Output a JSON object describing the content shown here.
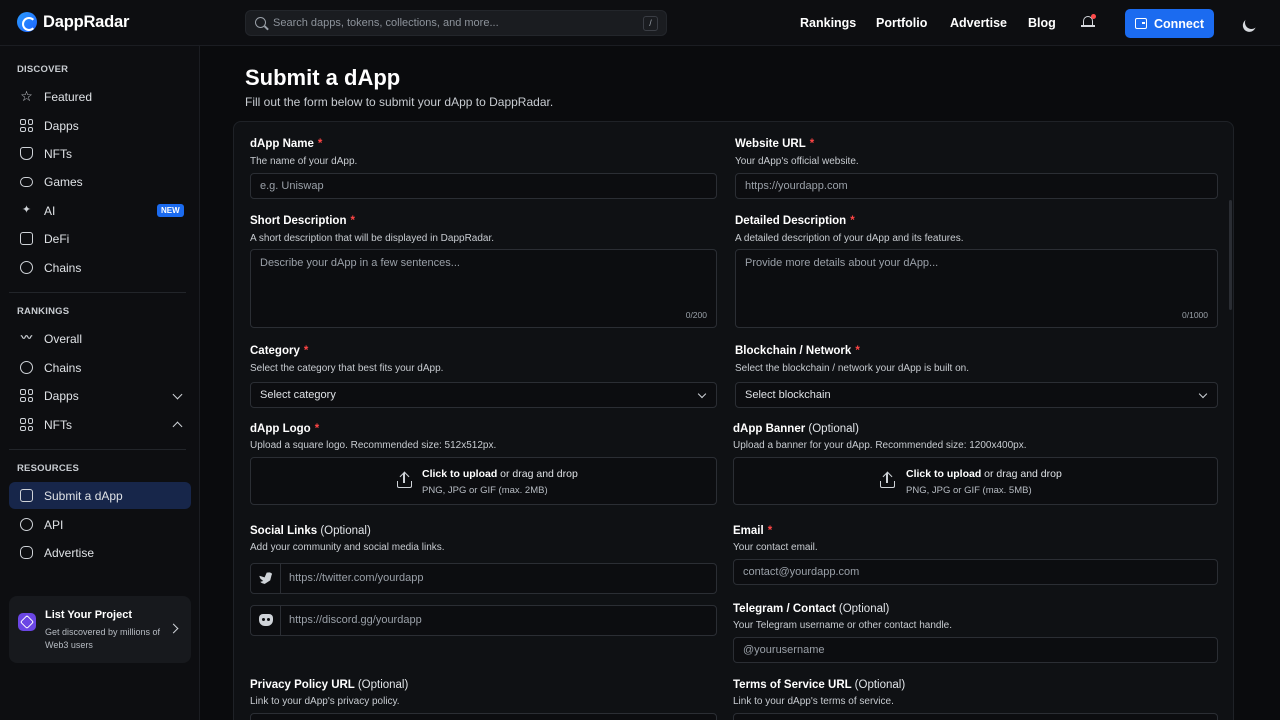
{
  "brand": {
    "name": "DappRadar"
  },
  "search": {
    "placeholder": "Search dapps, tokens, collections, and more...",
    "shortcut": "/"
  },
  "topnav": {
    "items": [
      "Rankings",
      "Portfolio",
      "Advertise",
      "Blog"
    ],
    "connect": "Connect"
  },
  "colors": {
    "accent": "#1b6bf0",
    "active_bg": "#17264a",
    "required": "#ff4545",
    "notification": "#ff4b4b"
  },
  "sidebar": {
    "discover_title": "DISCOVER",
    "discover": [
      {
        "label": "Featured",
        "icon": "star-icon"
      },
      {
        "label": "Dapps",
        "icon": "grid-icon"
      },
      {
        "label": "NFTs",
        "icon": "nft-icon"
      },
      {
        "label": "Games",
        "icon": "gamepad-icon"
      },
      {
        "label": "AI",
        "icon": "ai-sparkle-icon",
        "badge": "NEW"
      },
      {
        "label": "DeFi",
        "icon": "defi-icon"
      },
      {
        "label": "Chains",
        "icon": "chains-icon"
      }
    ],
    "rankings_title": "RANKINGS",
    "rankings": [
      {
        "label": "Overall",
        "icon": "trend-icon"
      },
      {
        "label": "Chains",
        "icon": "chains-icon"
      },
      {
        "label": "Dapps",
        "icon": "grid-icon",
        "chevron": "down"
      },
      {
        "label": "NFTs",
        "icon": "grid-icon",
        "chevron": "up"
      }
    ],
    "resources_title": "RESOURCES",
    "resources": [
      {
        "label": "Submit a dApp",
        "icon": "submit-icon",
        "active": true
      },
      {
        "label": "API",
        "icon": "api-icon"
      },
      {
        "label": "Advertise",
        "icon": "advertise-icon"
      }
    ],
    "promo": {
      "title": "List Your Project",
      "desc": "Get discovered by millions of Web3 users"
    }
  },
  "page": {
    "title": "Submit a dApp",
    "subtitle": "Fill out the form below to submit your dApp to DappRadar."
  },
  "form": {
    "dapp_name": {
      "label": "dApp Name",
      "help": "The name of your dApp.",
      "placeholder": "e.g. Uniswap"
    },
    "website": {
      "label": "Website URL",
      "help": "Your dApp's official website.",
      "placeholder": "https://yourdapp.com"
    },
    "short_desc": {
      "label": "Short Description",
      "help": "A short description that will be displayed in DappRadar.",
      "placeholder": "Describe your dApp in a few sentences...",
      "counter": "0/200"
    },
    "detailed_desc": {
      "label": "Detailed Description",
      "help": "A detailed description of your dApp and its features.",
      "placeholder": "Provide more details about your dApp...",
      "counter": "0/1000"
    },
    "category": {
      "label": "Category",
      "help": "Select the category that best fits your dApp.",
      "value": "Select category"
    },
    "blockchain": {
      "label": "Blockchain / Network",
      "help": "Select the blockchain / network your dApp is built on.",
      "value": "Select blockchain"
    },
    "logo": {
      "label": "dApp Logo",
      "help": "Upload a square logo. Recommended size: 512x512px.",
      "cta": "Click to upload",
      "cta_rest": " or drag and drop",
      "formats": "PNG, JPG or GIF (max. 2MB)"
    },
    "banner": {
      "label": "dApp Banner",
      "optional": "(Optional)",
      "help": "Upload a banner for your dApp. Recommended size: 1200x400px.",
      "cta": "Click to upload",
      "cta_rest": " or drag and drop",
      "formats": "PNG, JPG or GIF (max. 5MB)"
    },
    "social": {
      "label": "Social Links",
      "optional": "(Optional)",
      "help": "Add your community and social media links.",
      "twitter_placeholder": "https://twitter.com/yourdapp",
      "discord_placeholder": "https://discord.gg/yourdapp"
    },
    "email": {
      "label": "Email",
      "help": "Your contact email.",
      "placeholder": "contact@yourdapp.com"
    },
    "telegram": {
      "label": "Telegram / Contact",
      "optional": "(Optional)",
      "help": "Your Telegram username or other contact handle.",
      "placeholder": "@yourusername"
    },
    "privacy": {
      "label": "Privacy Policy URL",
      "optional": "(Optional)",
      "help": "Link to your dApp's privacy policy."
    },
    "terms": {
      "label": "Terms of Service URL",
      "optional": "(Optional)",
      "help": "Link to your dApp's terms of service."
    }
  }
}
